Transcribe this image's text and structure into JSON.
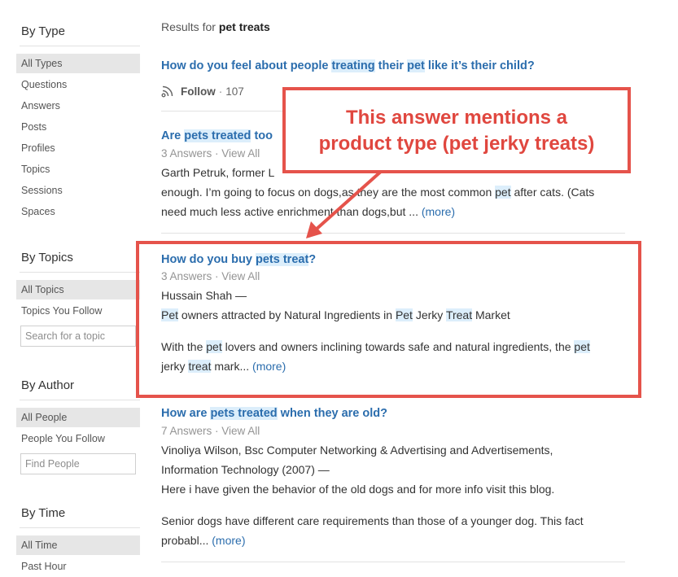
{
  "sidebar": {
    "by_type": {
      "title": "By Type",
      "options": [
        "All Types",
        "Questions",
        "Answers",
        "Posts",
        "Profiles",
        "Topics",
        "Sessions",
        "Spaces"
      ]
    },
    "by_topics": {
      "title": "By Topics",
      "options": [
        "All Topics",
        "Topics You Follow"
      ],
      "search_placeholder": "Search for a topic"
    },
    "by_author": {
      "title": "By Author",
      "options": [
        "All People",
        "People You Follow"
      ],
      "search_placeholder": "Find People"
    },
    "by_time": {
      "title": "By Time",
      "options": [
        "All Time",
        "Past Hour"
      ]
    }
  },
  "results": {
    "prefix": "Results for",
    "query": "pet treats",
    "items": [
      {
        "title_parts": [
          "How do you feel about people ",
          "treating",
          " their ",
          "pet",
          " like it’s their child?"
        ],
        "follow_label": "Follow",
        "follow_count": "107"
      },
      {
        "title_parts": [
          "Are ",
          "pets treated",
          " too"
        ],
        "meta": "3 Answers · View All",
        "line1": "Garth Petruk, former L",
        "line2_parts": [
          "enough. I’m going to focus on dogs,as they are the most common ",
          "pet",
          " after cats. (Cats"
        ],
        "line3": "need much less active enrichment than dogs,but ...",
        "more": "(more)"
      },
      {
        "title_parts": [
          "How do you buy ",
          "pets treat",
          "?"
        ],
        "meta": "3 Answers · View All",
        "author": "Hussain Shah —",
        "line1_parts": [
          "Pet",
          " owners attracted by Natural Ingredients in ",
          "Pet",
          " Jerky ",
          "Treat",
          " Market"
        ],
        "line2_parts": [
          "With the ",
          "pet",
          " lovers and owners inclining towards safe and natural ingredients, the ",
          "pet"
        ],
        "line3_parts": [
          "jerky ",
          "treat",
          " mark..."
        ],
        "more": "(more)"
      },
      {
        "title_parts": [
          "How are ",
          "pets treated",
          " when they are old?"
        ],
        "meta": "7 Answers · View All",
        "author1": "Vinoliya Wilson, Bsc Computer Networking & Advertising and Advertisements,",
        "author2": "Information Technology (2007) —",
        "line1": "Here i have given the behavior of the old dogs and for more info visit this blog.",
        "line2": "Senior dogs have different care requirements than those of a younger dog. This fact",
        "line3": "probabl...",
        "more": "(more)"
      }
    ]
  },
  "annotation": {
    "line1": "This answer mentions a",
    "line2": "product type (pet jerky treats)",
    "color": "#e5534b"
  },
  "colors": {
    "link": "#2b6dad",
    "highlight": "#dceefb",
    "selected_option": "#e6e6e6"
  }
}
